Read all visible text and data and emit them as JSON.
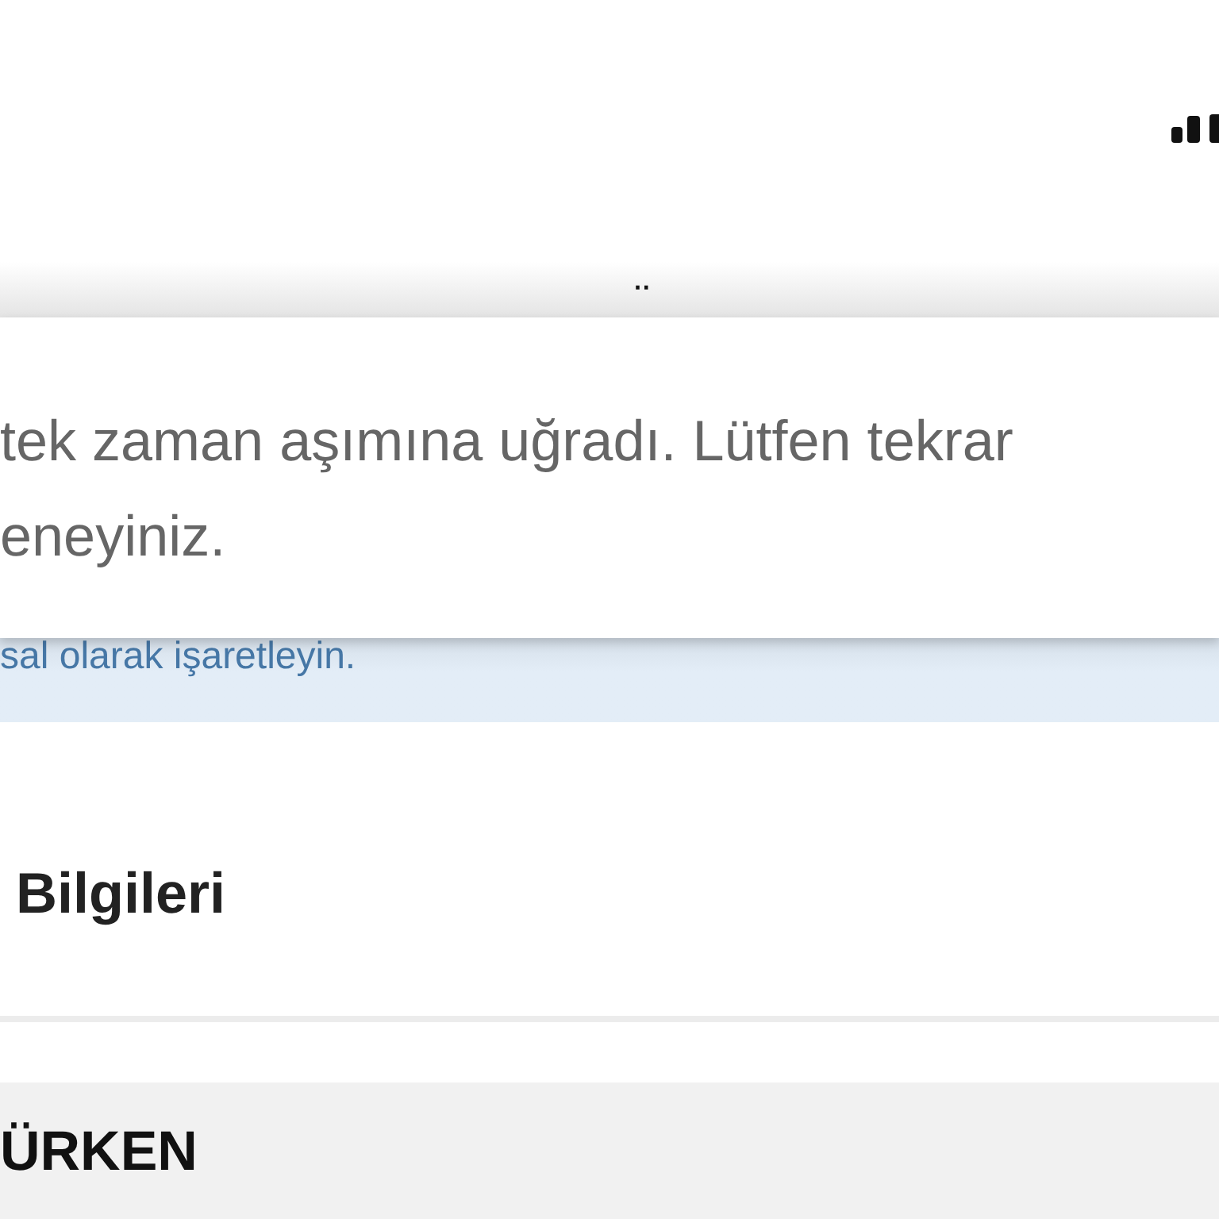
{
  "partial_heading": {
    "text": "¨"
  },
  "dialog": {
    "message_lines": [
      "tek zaman aşımına uğradı. Lütfen tekrar",
      "eneyiniz."
    ]
  },
  "info_banner": {
    "text": "sal olarak işaretleyin."
  },
  "section": {
    "title": "Bilgileri"
  },
  "group_header": {
    "title": "ÜRKEN"
  }
}
